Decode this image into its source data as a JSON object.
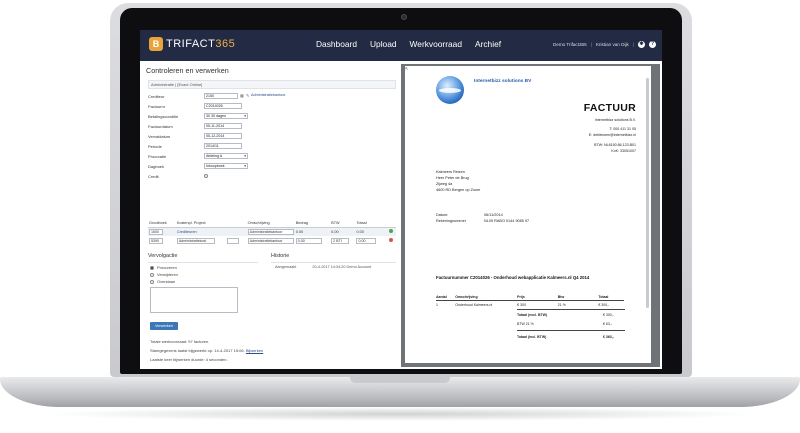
{
  "app": {
    "logo_badge": "B",
    "logo_text": "TRIFACT",
    "logo_num": "365",
    "nav": [
      "Dashboard",
      "Upload",
      "Werkvoorraad",
      "Archief"
    ],
    "company": "Demo Trifact365",
    "separator": "|",
    "user": "Kristian van Dijk",
    "settings_icon": "gear-icon",
    "help_icon": "help-icon"
  },
  "page": {
    "title": "Controleren en verwerken",
    "breadcrumb": "Administratie | [Exact Online]"
  },
  "form": {
    "crediteur_label": "Crediteur",
    "crediteur_value": "2150",
    "admin_link": "Administratiekantoor",
    "factuurnr_label": "Factuurnr",
    "factuurnr_value": "C2014026",
    "betalingsconditie_label": "Betalingsconditie",
    "betalingsconditie_value": "30 30 dagen",
    "factuurdatum_label": "Factuurdatum",
    "factuurdatum_value": "05-11-2014",
    "vervaldatum_label": "Vervaldatum",
    "vervaldatum_value": "05-12-2014",
    "periode_label": "Periode",
    "periode_value": "2014/11",
    "procuratie_label": "Procuratie",
    "procuratie_value": "Afdeling A",
    "dagboek_label": "Dagboek",
    "dagboek_value": "Inkoopboek",
    "credit_label": "Credit"
  },
  "lines": {
    "headers": [
      "Grootboek",
      "Kostenpl.",
      "Project",
      "Omschrijving",
      "Bedrag",
      "BTW",
      "Totaal"
    ],
    "rows": [
      {
        "gb": "1600",
        "gb_name": "Crediteuren",
        "kpl": "",
        "proj": "",
        "oms": "Administratiekantoor",
        "bedrag": "0.00",
        "btw": "",
        "btwbedrag": "0,00",
        "totaal": "0.00"
      },
      {
        "gb": "5390",
        "gb_name": "Administratiekost",
        "kpl": "",
        "proj": "",
        "oms": "Administratiekantoor",
        "bedrag": "0.00",
        "btw": "2 BTI",
        "btwbedrag": "0.00",
        "totaal": "0.00"
      }
    ]
  },
  "vervolg": {
    "title": "Vervolgactie",
    "options": [
      "Procureren",
      "Verwijderen",
      "Overslaan"
    ],
    "button": "Verwerken"
  },
  "historie": {
    "title": "Historie",
    "event": "Aangemaakt",
    "datetime": "20-4-2017 14:34:20",
    "who": "Demo Account"
  },
  "info": {
    "line1": "Totale werkvoorraad: 97 facturen.",
    "line2_prefix": "Stamgegevens laatst bijgewerkt op: 14-4-2017 15:06.",
    "line2_link": "Bijwerken",
    "line3": "Laatste keer bijwerken duurde: 4 seconden."
  },
  "invoice": {
    "corner": "⇱",
    "company": "Internetbizz solutions BV",
    "heading": "FACTUUR",
    "addr": [
      "Internetbizz solutions B.V.",
      "T: 000 411 31 05",
      "E: debiteuren@internetbizz.nl",
      "BTW: NL8150.86.123.B01",
      "KvK: 33051007"
    ],
    "client": [
      "Kalmeers Reizen",
      "Heer Peter de Brug",
      "Zijweg 4a",
      "4600 RD  Bergen op Zoom"
    ],
    "datum_label": "Datum:",
    "datum_value": "06/11/2014",
    "rekening_label": "Rekeningnummer",
    "rekening_value": "NL09 RABO 0144 9085 97",
    "subject": "Factuurnummer C2014026 - Onderhoud webapplicatie Kalmeers.nl Q4 2014",
    "table_headers": [
      "Aantal",
      "Omschrijving",
      "Prijs",
      "Btw",
      "Totaal"
    ],
    "table_row": [
      "1",
      "Onderhoud Kalmeers.nl",
      "€ 300",
      "21 %",
      "€ 300,-"
    ],
    "totaal_excl_label": "Totaal (excl. BTW)",
    "totaal_excl_value": "€ 300,-",
    "btw_label": "BTW 21 %",
    "btw_value": "€ 63,-",
    "totaal_incl_label": "Totaal (incl. BTW)",
    "totaal_incl_value": "€ 363,-"
  }
}
